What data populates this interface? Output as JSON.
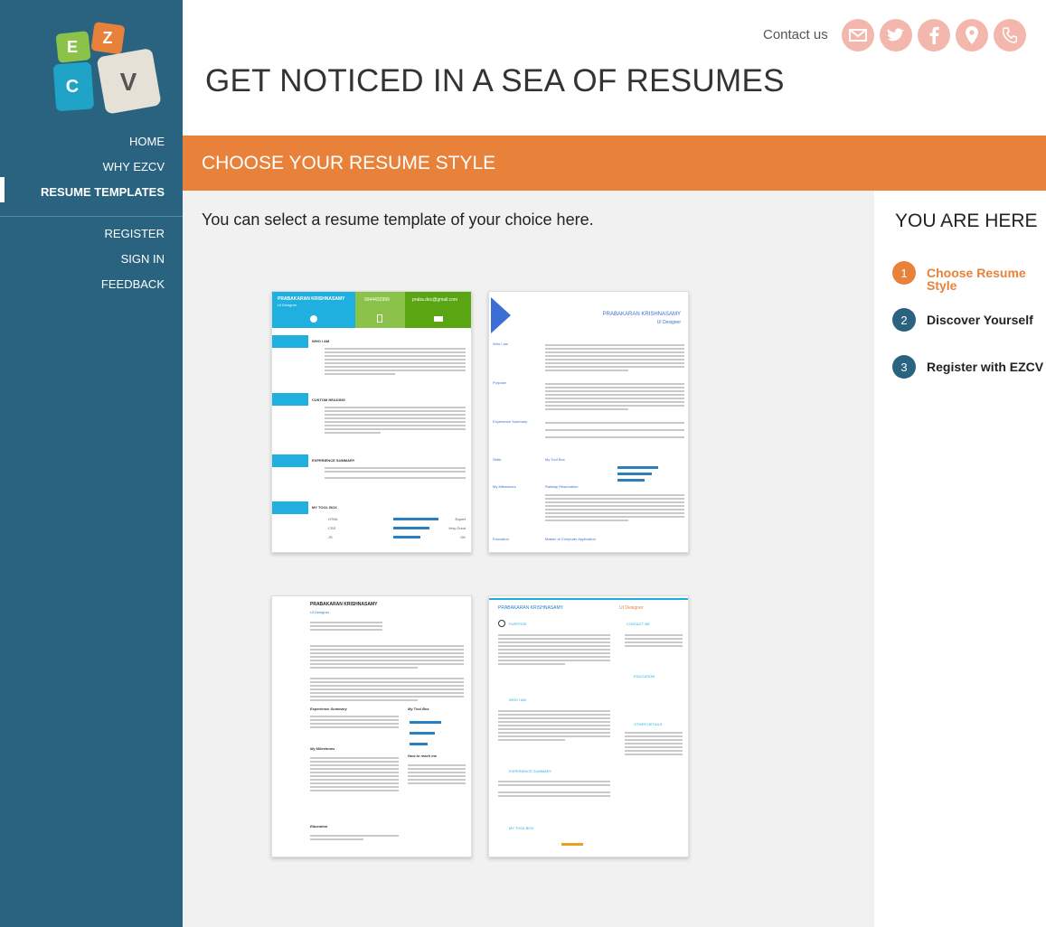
{
  "brand": {
    "logo_letters": [
      "E",
      "Z",
      "C",
      "V"
    ],
    "colors": {
      "sidebar": "#2a6380",
      "accent": "#e8823a",
      "social": "#f3b7ad"
    }
  },
  "nav": {
    "items": [
      {
        "label": "HOME"
      },
      {
        "label": "WHY EZCV"
      },
      {
        "label": "RESUME TEMPLATES",
        "active": true
      },
      {
        "label": "REGISTER"
      },
      {
        "label": "SIGN IN"
      },
      {
        "label": "FEEDBACK"
      }
    ]
  },
  "header": {
    "contact_label": "Contact us",
    "social_icons": [
      "mail-icon",
      "twitter-icon",
      "facebook-icon",
      "location-icon",
      "phone-icon"
    ],
    "headline": "GET NOTICED IN A SEA OF RESUMES"
  },
  "section": {
    "title": "CHOOSE YOUR RESUME STYLE",
    "intro": "You can select a resume template of your choice here."
  },
  "progress": {
    "title": "YOU ARE HERE",
    "steps": [
      {
        "num": "1",
        "label": "Choose Resume Style",
        "active": true
      },
      {
        "num": "2",
        "label": "Discover Yourself"
      },
      {
        "num": "3",
        "label": "Register with EZCV"
      }
    ]
  },
  "templates": {
    "t1": {
      "name": "PRABAKARAN KRISHNASAMY",
      "role": "UI Designer",
      "phone": "9944432999",
      "email": "praba.dec@gmail.com",
      "sections": [
        "WHO I AM",
        "CUSTOM HEADING",
        "EXPERIENCE SUMMARY",
        "MY TOOL BOX"
      ],
      "skills": [
        {
          "name": "HTML",
          "level": "Expert"
        },
        {
          "name": "CSS",
          "level": "Very Good"
        },
        {
          "name": "JS",
          "level": "OK"
        }
      ]
    },
    "t2": {
      "name": "PRABAKARAN KRISHNASAMY",
      "role": "UI Designer",
      "sections": [
        "Who I am",
        "Purpose",
        "Experience Summary",
        "Skills",
        "My Milestones",
        "Education"
      ],
      "subheads": [
        "My Tool Box",
        "Railway Reservation",
        "Master of Computer Application"
      ]
    },
    "t3": {
      "name": "PRABAKARAN KRISHNASAMY",
      "role": "UI Designer",
      "sections": [
        "Experience Summary",
        "My Tool Box",
        "My Milestones",
        "How to reach me",
        "Education"
      ]
    },
    "t4": {
      "name": "PRABAKARAN KRISHNASAMY",
      "role": "UI Designer",
      "sections": [
        "PURPOSE",
        "CONTACT ME",
        "EDUCATION",
        "WHO I AM",
        "OTHER DETAILS",
        "EXPERIENCE SUMMARY",
        "MY TOOL BOX"
      ]
    }
  }
}
